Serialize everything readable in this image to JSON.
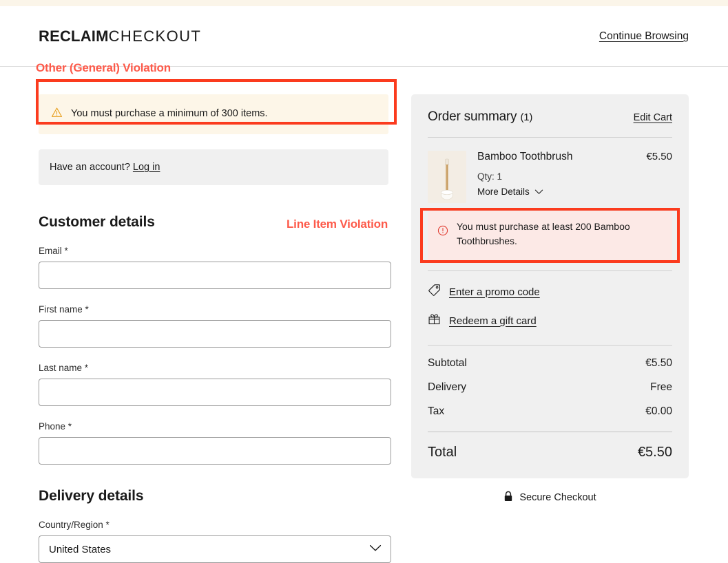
{
  "header": {
    "brand_strong": "RECLAIM",
    "brand_light": "CHECKOUT",
    "continue_browsing": "Continue Browsing"
  },
  "annotations": {
    "general_label": "Other (General) Violation",
    "line_item_label": "Line Item Violation",
    "border_color": "#FB3B1E",
    "label_color": "#FD5A4A"
  },
  "general_warning": {
    "icon": "warning-triangle-icon",
    "message": "You must purchase a minimum of 300 items.",
    "background": "#FDF6E8"
  },
  "account": {
    "prompt": "Have an account?",
    "login_label": "Log in"
  },
  "customer_details": {
    "title": "Customer details",
    "fields": [
      {
        "label": "Email *",
        "value": "",
        "placeholder": ""
      },
      {
        "label": "First name *",
        "value": "",
        "placeholder": ""
      },
      {
        "label": "Last name *",
        "value": "",
        "placeholder": ""
      },
      {
        "label": "Phone *",
        "value": "",
        "placeholder": ""
      }
    ]
  },
  "delivery_details": {
    "title": "Delivery details",
    "country_label": "Country/Region *",
    "country_value": "United States"
  },
  "order_summary": {
    "title": "Order summary",
    "count": "(1)",
    "edit_cart": "Edit Cart",
    "item": {
      "name": "Bamboo Toothbrush",
      "price": "€5.50",
      "qty": "Qty: 1",
      "more_details": "More Details"
    },
    "error": {
      "icon": "error-circle-icon",
      "message": "You must purchase at least 200 Bamboo Toothbrushes.",
      "background": "#FCE9E6"
    },
    "promo": {
      "promo_code_label": "Enter a promo code",
      "promo_code_icon": "tag-icon",
      "gift_card_label": "Redeem a gift card",
      "gift_card_icon": "gift-icon"
    },
    "totals": [
      {
        "label": "Subtotal",
        "value": "€5.50"
      },
      {
        "label": "Delivery",
        "value": "Free"
      },
      {
        "label": "Tax",
        "value": "€0.00"
      }
    ],
    "grand_total": {
      "label": "Total",
      "value": "€5.50"
    }
  },
  "footer": {
    "secure_label": "Secure Checkout",
    "secure_icon": "lock-icon"
  }
}
